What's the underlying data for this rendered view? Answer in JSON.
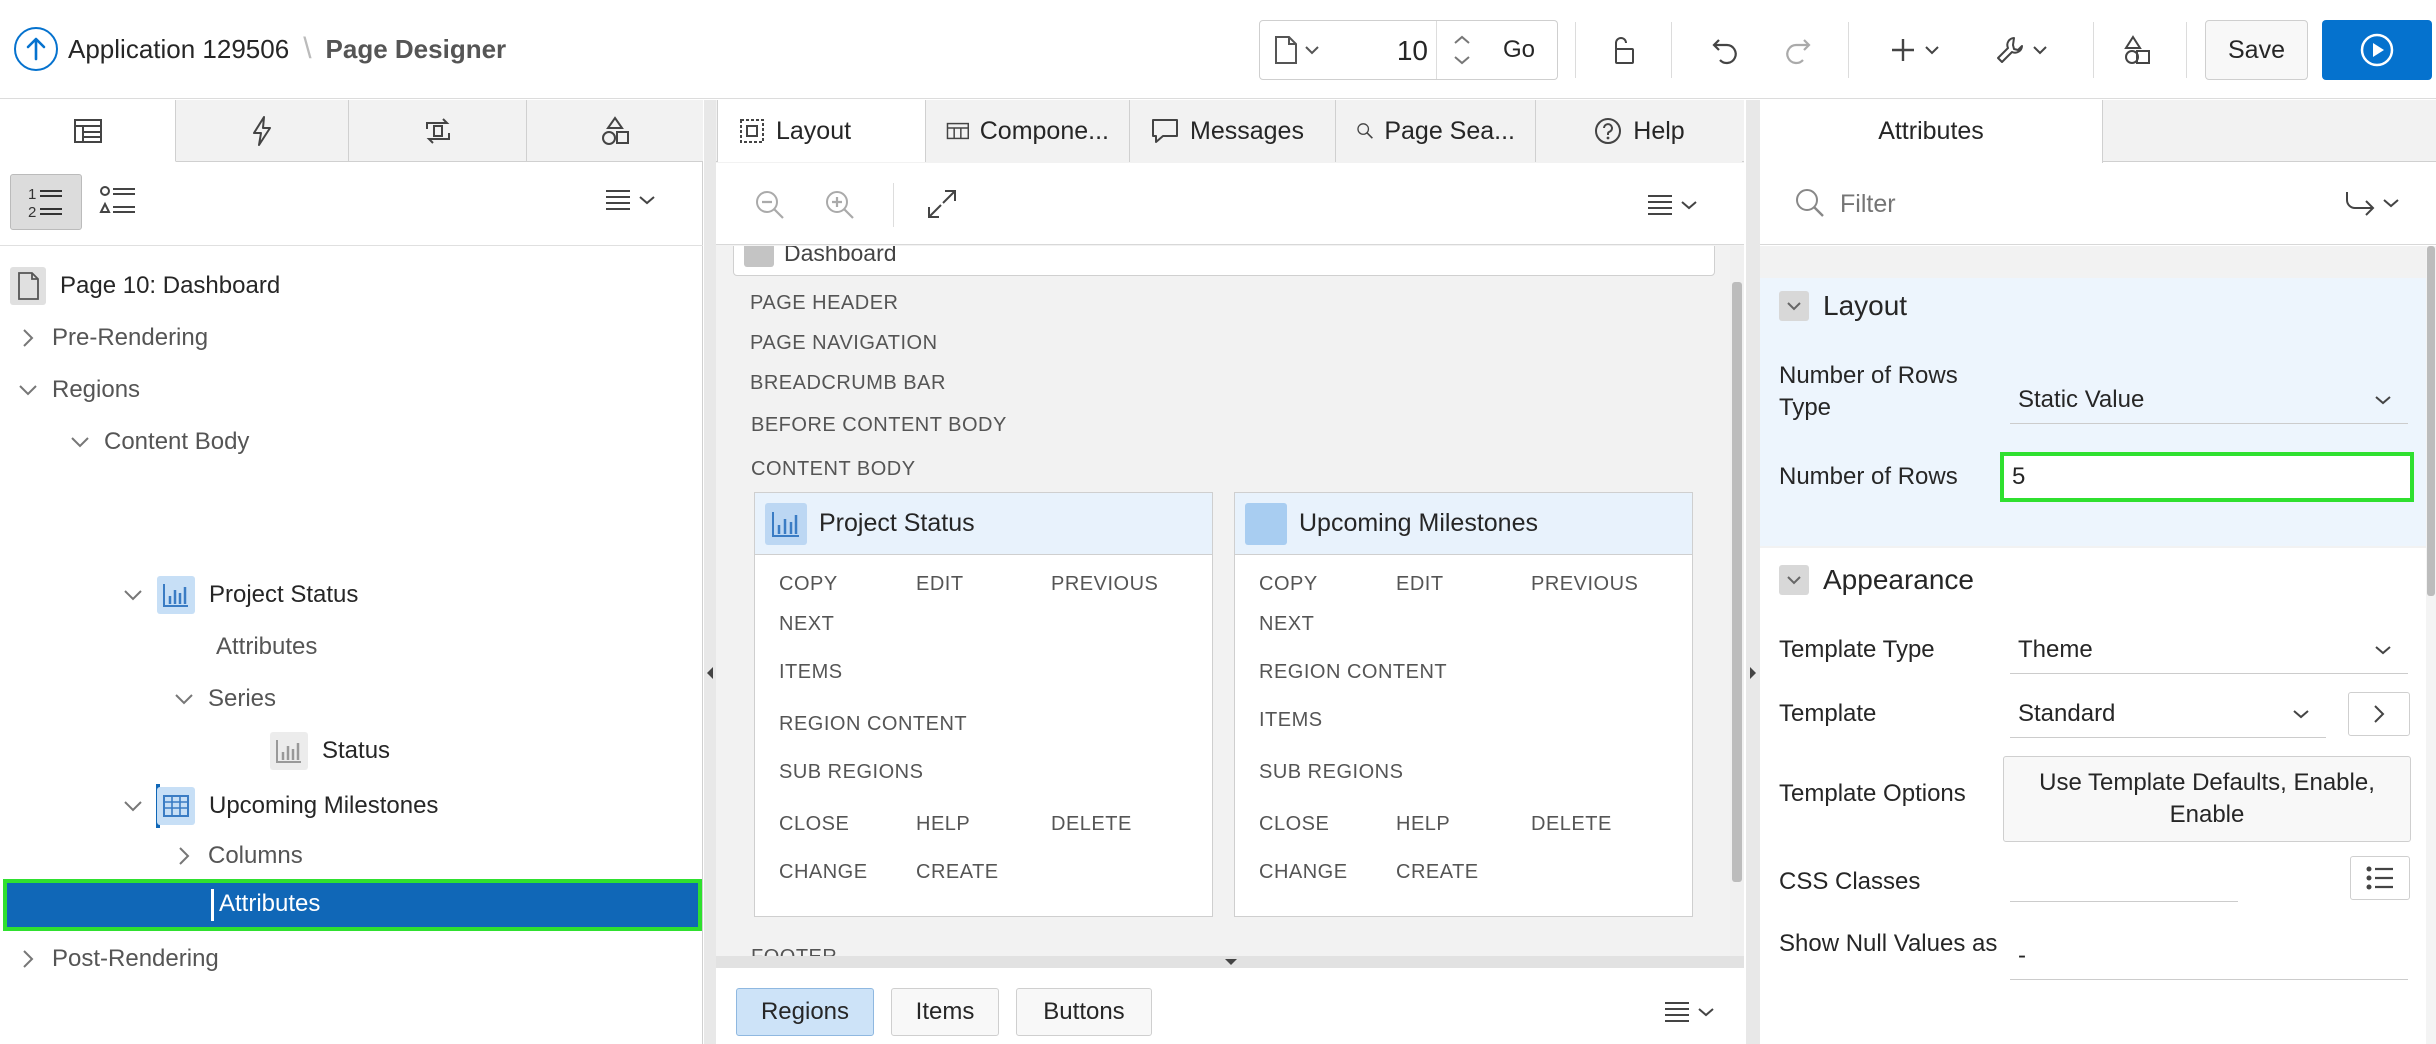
{
  "header": {
    "app_name": "Application 129506",
    "page_designer": "Page Designer",
    "page_number": "10",
    "go_label": "Go",
    "save_label": "Save"
  },
  "left_panel": {
    "tree": [
      {
        "label": "Page 10: Dashboard"
      },
      {
        "label": "Pre-Rendering"
      },
      {
        "label": "Regions"
      },
      {
        "label": "Content Body"
      },
      {
        "label": "Project Status"
      },
      {
        "label": "Attributes"
      },
      {
        "label": "Series"
      },
      {
        "label": "Status"
      },
      {
        "label": "Upcoming Milestones"
      },
      {
        "label": "Columns"
      },
      {
        "label": "Attributes"
      },
      {
        "label": "Post-Rendering"
      }
    ]
  },
  "center_panel": {
    "tabs": [
      "Layout",
      "Compone...",
      "Messages",
      "Page Sea...",
      "Help"
    ],
    "page_title": "Dashboard",
    "positions": [
      "PAGE HEADER",
      "PAGE NAVIGATION",
      "BREADCRUMB BAR",
      "BEFORE CONTENT BODY",
      "CONTENT BODY",
      "FOOTER"
    ],
    "region1": {
      "title": "Project Status",
      "labels": [
        "COPY",
        "EDIT",
        "PREVIOUS",
        "NEXT",
        "ITEMS",
        "REGION CONTENT",
        "SUB REGIONS",
        "CLOSE",
        "HELP",
        "DELETE",
        "CHANGE",
        "CREATE"
      ]
    },
    "region2": {
      "title": "Upcoming Milestones",
      "labels": [
        "COPY",
        "EDIT",
        "PREVIOUS",
        "NEXT",
        "REGION CONTENT",
        "ITEMS",
        "SUB REGIONS",
        "CLOSE",
        "HELP",
        "DELETE",
        "CHANGE",
        "CREATE"
      ]
    },
    "bottom_tabs": [
      "Regions",
      "Items",
      "Buttons"
    ]
  },
  "right_panel": {
    "tab": "Attributes",
    "filter_placeholder": "Filter",
    "groups": {
      "layout": "Layout",
      "appearance": "Appearance"
    },
    "props": {
      "rows_type_label": "Number of Rows Type",
      "rows_type_value": "Static Value",
      "rows_label": "Number of Rows",
      "rows_value": "5",
      "template_type_label": "Template Type",
      "template_type_value": "Theme",
      "template_label": "Template",
      "template_value": "Standard",
      "template_options_label": "Template Options",
      "template_options_value": "Use Template Defaults, Enable, Enable",
      "css_classes_label": "CSS Classes",
      "show_null_label": "Show Null Values as",
      "show_null_value": "-"
    }
  },
  "colors": {
    "accent": "#0572ce",
    "selection": "#1067b7",
    "highlight": "#2fe02f",
    "region_header": "#e8f2fc"
  }
}
